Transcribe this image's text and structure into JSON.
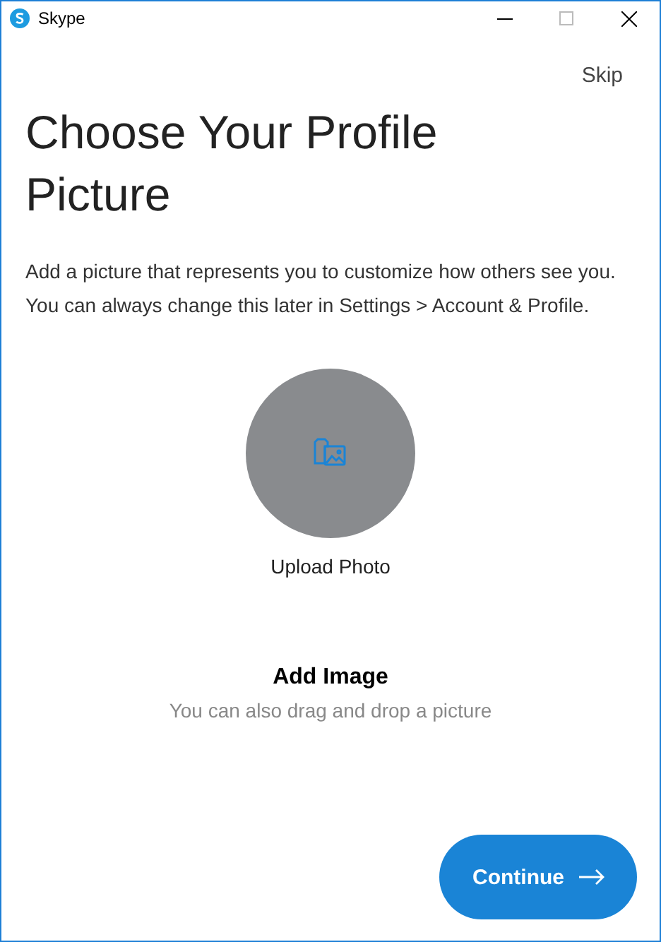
{
  "window": {
    "title": "Skype"
  },
  "skip": "Skip",
  "heading": "Choose Your Profile Picture",
  "description": "Add a picture that represents you to customize how others see you. You can always change this later in Settings > Account & Profile.",
  "upload": {
    "label": "Upload Photo"
  },
  "add_image": {
    "title": "Add Image",
    "hint": "You can also drag and drop a picture"
  },
  "continue_button": "Continue"
}
